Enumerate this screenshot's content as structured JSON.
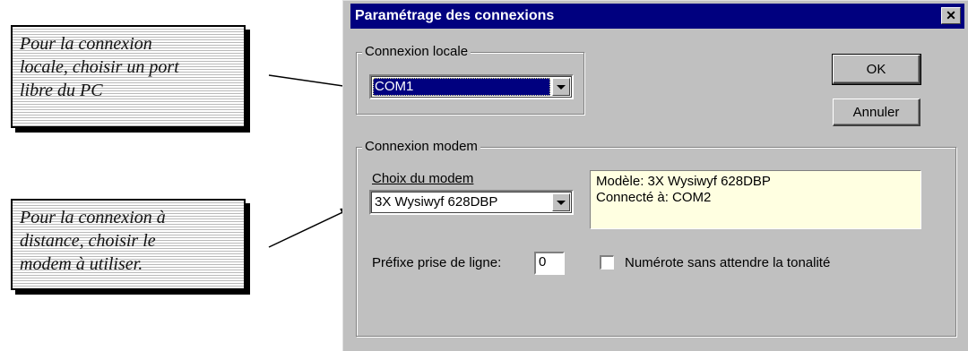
{
  "callouts": {
    "local": [
      "Pour la connexion",
      "locale, choisir un port",
      "libre du PC"
    ],
    "modem": [
      "Pour la connexion à",
      "distance, choisir le",
      "modem à utiliser."
    ]
  },
  "dialog": {
    "title": "Paramétrage des connexions",
    "close_glyph": "✕",
    "local_group": {
      "legend": "Connexion locale",
      "port_value": "COM1"
    },
    "buttons": {
      "ok": "OK",
      "cancel": "Annuler"
    },
    "modem_group": {
      "legend": "Connexion modem",
      "choice_label": "Choix du modem",
      "modem_value": "3X Wysiwyf 628DBP",
      "info_line1": "Modèle: 3X Wysiwyf 628DBP",
      "info_line2": "Connecté à:  COM2",
      "prefix_label": "Préfixe prise de ligne:",
      "prefix_value": "0",
      "dial_checkbox_label": "Numérote sans attendre la tonalité"
    }
  }
}
